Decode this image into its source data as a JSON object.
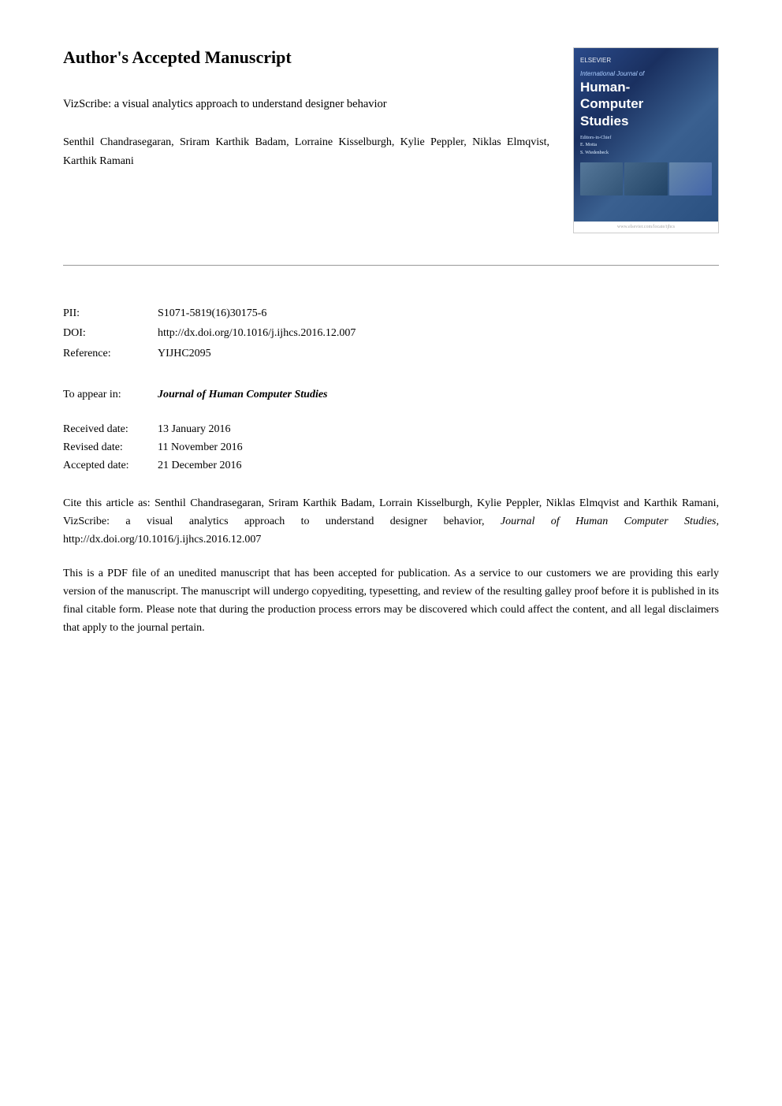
{
  "page": {
    "background": "#ffffff"
  },
  "header": {
    "main_title": "Author's Accepted Manuscript",
    "paper_title": "VizScribe: a visual analytics approach to understand designer behavior",
    "authors": "Senthil Chandrasegaran, Sriram Karthik Badam, Lorraine Kisselburgh, Kylie Peppler, Niklas Elmqvist, Karthik Ramani"
  },
  "journal_cover": {
    "logo": "ELSEVIER",
    "title": "Human-\nComputer\nStudies",
    "subtitle": "International Journal of",
    "editors_label": "Editors-in-Chief",
    "editors": "E. Motta\nS. Wiedenbeck",
    "url": "www.elsevier.com/locate/ijhcs"
  },
  "metadata": {
    "pii_label": "PII:",
    "pii_value": "S1071-5819(16)30175-6",
    "doi_label": "DOI:",
    "doi_value": "http://dx.doi.org/10.1016/j.ijhcs.2016.12.007",
    "reference_label": "Reference:",
    "reference_value": "YIJHC2095"
  },
  "appear": {
    "label": "To appear in:",
    "value": "Journal of Human Computer Studies"
  },
  "dates": {
    "received_label": "Received date:",
    "received_value": "13 January 2016",
    "revised_label": "Revised date:",
    "revised_value": "11 November 2016",
    "accepted_label": "Accepted date:",
    "accepted_value": "21 December 2016"
  },
  "cite": {
    "prefix": "Cite this article as: Senthil Chandrasegaran, Sriram Karthik Badam, Lorrain Kisselburgh, Kylie Peppler, Niklas Elmqvist and Karthik Ramani, VizScribe: a visual analytics approach to understand designer behavior, ",
    "journal": "Journal of Human Computer Studies,",
    "suffix": " http://dx.doi.org/10.1016/j.ijhcs.2016.12.007"
  },
  "body": {
    "text": "This is a PDF file of an unedited manuscript that has been accepted for publication. As a service to our customers we are providing this early version of the manuscript. The manuscript will undergo copyediting, typesetting, and review of the resulting galley proof before it is published in its final citable form. Please note that during the production process errors may be discovered which could affect the content, and all legal disclaimers that apply to the journal pertain."
  }
}
